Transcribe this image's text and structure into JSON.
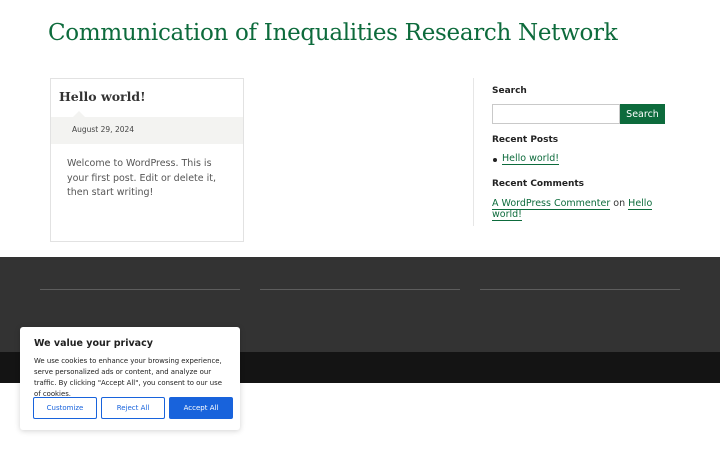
{
  "header": {
    "site_title": "Communication of Inequalities Research Network"
  },
  "post": {
    "title": "Hello world!",
    "date": "August 29, 2024",
    "excerpt": "Welcome to WordPress. This is your first post. Edit or delete it, then start writing!"
  },
  "sidebar": {
    "search_title": "Search",
    "search_value": "",
    "search_button": "Search",
    "recent_posts_title": "Recent Posts",
    "recent_posts": [
      {
        "label": "Hello world!"
      }
    ],
    "recent_comments_title": "Recent Comments",
    "comment_author": "A WordPress Commenter",
    "comment_on": "on",
    "comment_post": "Hello world!"
  },
  "cookie": {
    "title": "We value your privacy",
    "text": "We use cookies to enhance your browsing experience, serve personalized ads or content, and analyze our traffic. By clicking \"Accept All\", you consent to our use of cookies.",
    "customize": "Customize",
    "reject": "Reject All",
    "accept": "Accept All"
  },
  "colors": {
    "brand": "#0d6b3c",
    "cookie_accent": "#1863dc",
    "footer": "#333333",
    "footer_bottom": "#141414"
  }
}
